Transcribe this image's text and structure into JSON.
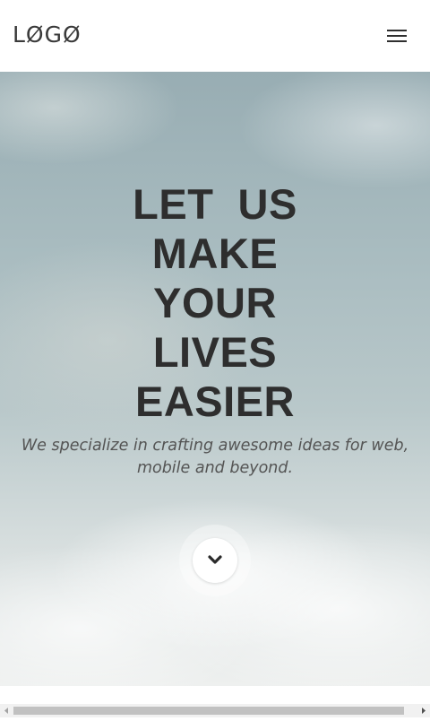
{
  "header": {
    "logo_text": "LØGØ",
    "menu_icon": "hamburger-menu-icon"
  },
  "hero": {
    "title_lines": [
      "LET  US",
      "MAKE",
      "YOUR",
      "LIVES",
      "EASIER"
    ],
    "subtitle": "We specialize in crafting awesome ideas for web, mobile and beyond.",
    "scroll_icon": "chevron-down-icon"
  },
  "colors": {
    "title": "#2e2e2e",
    "subtitle": "#545454",
    "logo": "#3a3a3a",
    "header_bg": "#ffffff",
    "sky_top": "#98adb3",
    "sky_bottom": "#eef0ef"
  }
}
